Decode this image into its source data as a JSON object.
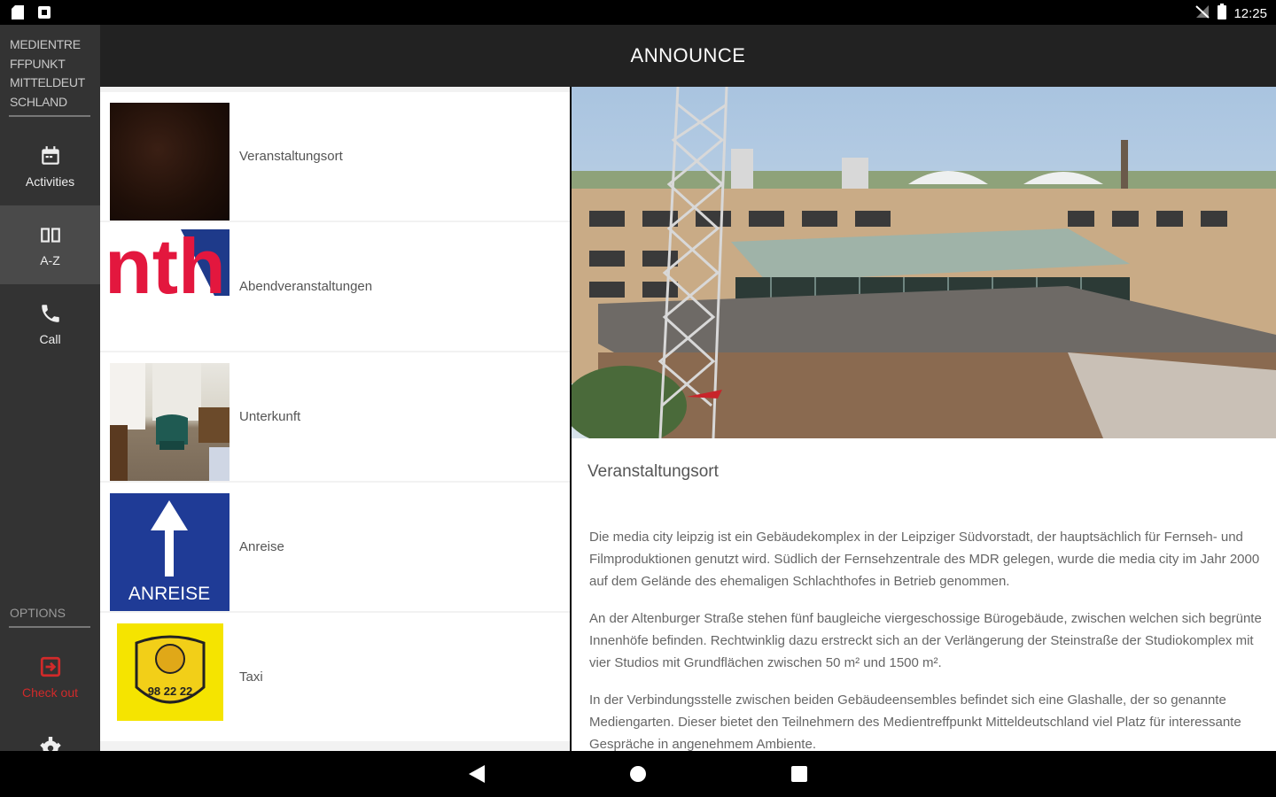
{
  "status_bar": {
    "time": "12:25"
  },
  "app_bar": {
    "title": "ANNOUNCE"
  },
  "sidebar": {
    "brand_lines": [
      "MEDIENTRE",
      "FFPUNKT",
      "MITTELDEUT",
      "SCHLAND"
    ],
    "items": [
      {
        "label": "Activities",
        "icon": "calendar-icon",
        "active": false
      },
      {
        "label": "A-Z",
        "icon": "book-icon",
        "active": true
      },
      {
        "label": "Call",
        "icon": "phone-icon",
        "active": false
      }
    ],
    "options_label": "OPTIONS",
    "checkout_label": "Check out",
    "colors": {
      "sidebar": "#333333",
      "active": "#4a4a4a",
      "checkout": "#d12a2a"
    }
  },
  "list": {
    "items": [
      {
        "label": "Veranstaltungsort",
        "thumb": "dark-texture"
      },
      {
        "label": "Abendveranstaltungen",
        "thumb": "logo-text",
        "thumb_text": "nth"
      },
      {
        "label": "Unterkunft",
        "thumb": "hotel-room"
      },
      {
        "label": "Anreise",
        "thumb": "sign",
        "thumb_text": "ANREISE"
      },
      {
        "label": "Taxi",
        "thumb": "taxi-badge",
        "thumb_text": "98 22 22"
      }
    ]
  },
  "detail": {
    "title": "Veranstaltungsort",
    "paragraphs": [
      "Die media city leipzig ist ein Gebäudekomplex in der Leipziger Südvorstadt, der hauptsächlich für Fernseh- und Filmproduktionen genutzt wird. Südlich der Fernsehzentrale des MDR gelegen, wurde die media city im Jahr 2000 auf dem Gelände des ehemaligen Schlachthofes in Betrieb genommen.",
      "An der Altenburger Straße stehen fünf baugleiche viergeschossige Bürogebäude, zwischen welchen sich begrünte Innenhöfe befinden. Rechtwinklig dazu erstreckt sich an der Verlängerung der Steinstraße der Studiokomplex mit vier Studios mit Grundflächen zwischen 50 m² und 1500 m².",
      "In der Verbindungsstelle zwischen beiden Gebäudeensembles befindet sich eine Glashalle, der so genannte Mediengarten. Dieser bietet den Teilnehmern des Medientreffpunkt Mitteldeutschland viel Platz für interessante Gespräche in angenehmem Ambiente."
    ]
  }
}
